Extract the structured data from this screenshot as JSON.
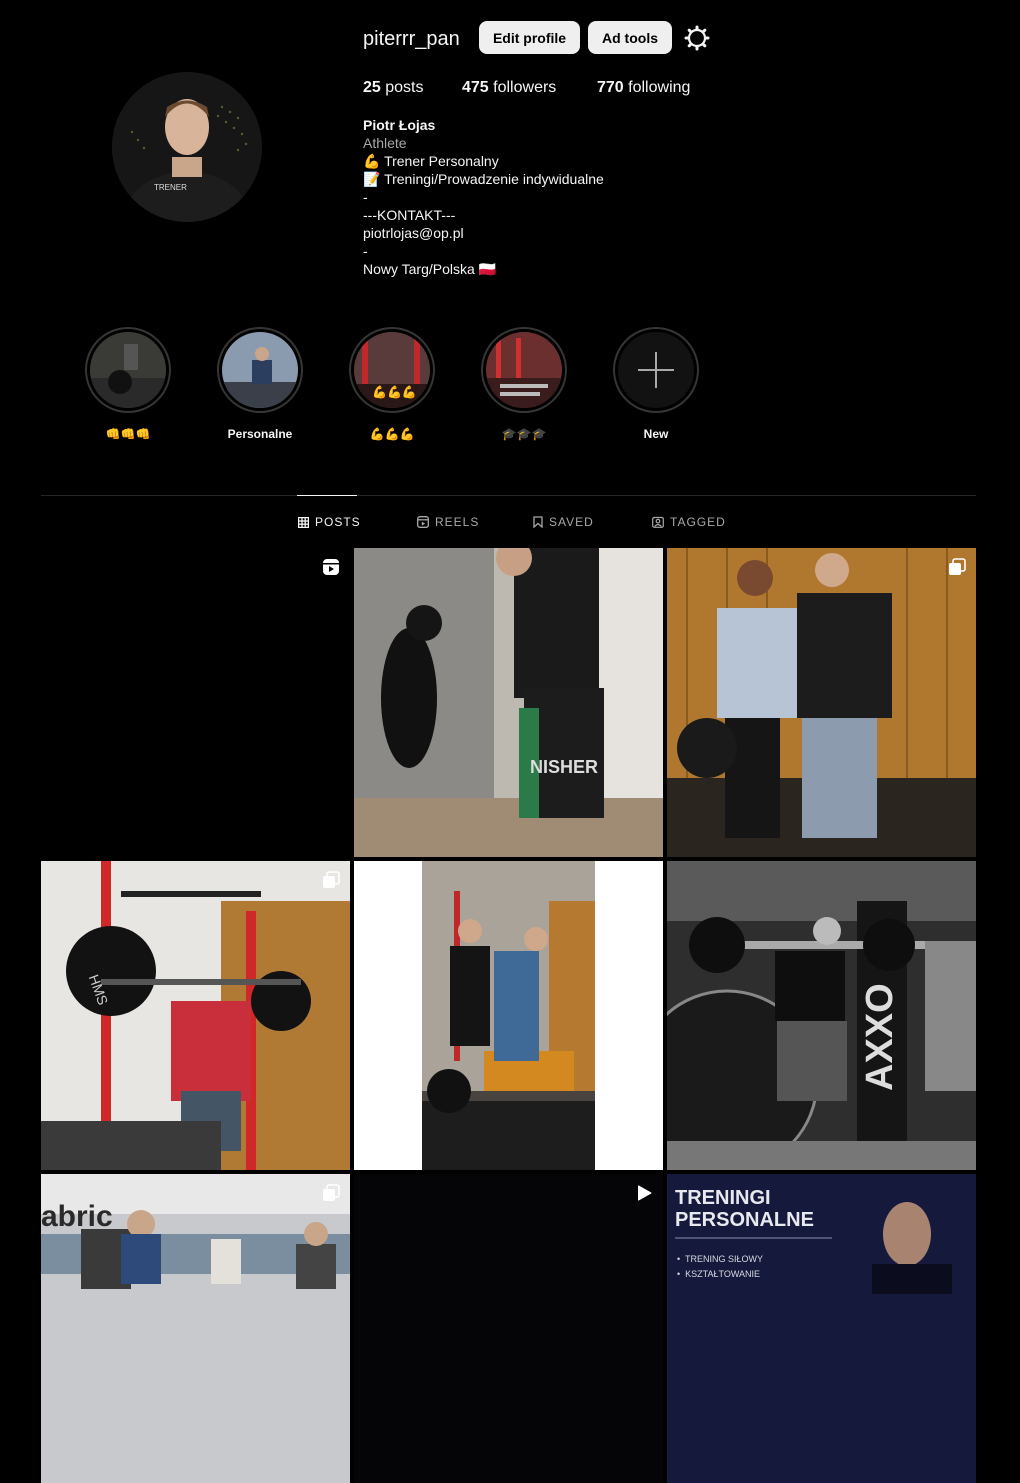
{
  "profile": {
    "username": "piterrr_pan",
    "edit_profile_label": "Edit profile",
    "ad_tools_label": "Ad tools",
    "stats": {
      "posts_count": "25",
      "posts_label": "posts",
      "followers_count": "475",
      "followers_label": "followers",
      "following_count": "770",
      "following_label": "following"
    },
    "bio": {
      "name": "Piotr Łojas",
      "category": "Athlete",
      "lines": [
        "💪 Trener Personalny",
        "📝 Treningi/Prowadzenie indywidualne",
        "-",
        "---KONTAKT---",
        "piotrlojas@op.pl",
        "-",
        "Nowy Targ/Polska 🇵🇱"
      ]
    }
  },
  "highlights": [
    {
      "label": "👊👊👊"
    },
    {
      "label": "Personalne"
    },
    {
      "label": "💪💪💪"
    },
    {
      "label": "🎓🎓🎓"
    },
    {
      "label": "New"
    }
  ],
  "tabs": [
    {
      "label": "POSTS",
      "icon": "grid-icon",
      "active": true
    },
    {
      "label": "REELS",
      "icon": "reels-icon",
      "active": false
    },
    {
      "label": "SAVED",
      "icon": "bookmark-icon",
      "active": false
    },
    {
      "label": "TAGGED",
      "icon": "tagged-icon",
      "active": false
    }
  ],
  "posts": [
    {
      "type": "reel",
      "overlay": "reels-icon"
    },
    {
      "type": "photo",
      "overlay": ""
    },
    {
      "type": "carousel",
      "overlay": "carousel-icon"
    },
    {
      "type": "carousel",
      "overlay": "carousel-icon"
    },
    {
      "type": "photo",
      "overlay": ""
    },
    {
      "type": "photo",
      "overlay": ""
    },
    {
      "type": "carousel",
      "overlay": "carousel-icon"
    },
    {
      "type": "video",
      "overlay": "play-icon"
    },
    {
      "type": "photo",
      "overlay": "",
      "text_title": "TRENINGI\nPERSONALNE",
      "text_items": [
        "TRENING SIŁOWY",
        "KSZTAŁTOWANIE"
      ]
    }
  ],
  "colors": {
    "background": "#000000",
    "button_bg": "#efefef",
    "muted_text": "#a8a8a8",
    "divider": "#262626"
  }
}
